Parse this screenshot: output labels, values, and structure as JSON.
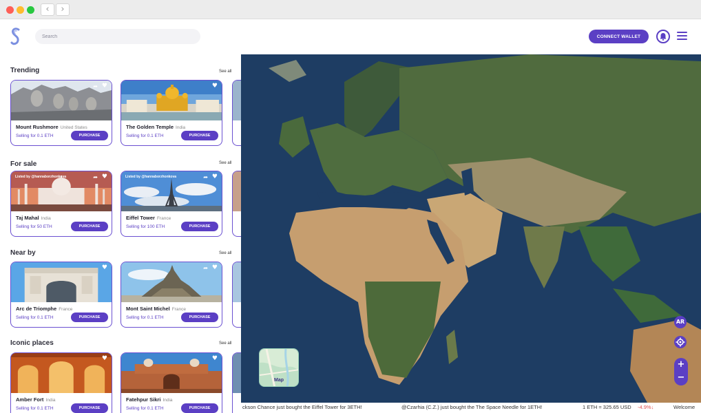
{
  "header": {
    "search_placeholder": "Search",
    "connect_label": "CONNECT WALLET"
  },
  "sections": [
    {
      "title": "Trending",
      "see_all": "See all",
      "cards": [
        {
          "name": "Mount Rushmore",
          "country": "United States",
          "price": "Selling for 0.1 ETH",
          "button": "PURCHASE"
        },
        {
          "name": "The Golden Temple",
          "country": "India",
          "price": "Selling for 0.1 ETH",
          "button": "PURCHASE"
        }
      ]
    },
    {
      "title": "For sale",
      "see_all": "See all",
      "cards": [
        {
          "name": "Taj Mahal",
          "country": "India",
          "price": "Selling for 50 ETH",
          "button": "PURCHASE",
          "listed": "Listed by @hannaborzhonkova"
        },
        {
          "name": "Eiffel Tower",
          "country": "France",
          "price": "Selling for 100 ETH",
          "button": "PURCHASE",
          "listed": "Listed by @hannaborzhonkova"
        }
      ]
    },
    {
      "title": "Near by",
      "see_all": "See all",
      "cards": [
        {
          "name": "Arc de Triomphe",
          "country": "France",
          "price": "Selling for 0.1 ETH",
          "button": "PURCHASE"
        },
        {
          "name": "Mont Saint Michel",
          "country": "France",
          "price": "Selling for 0.1 ETH",
          "button": "PURCHASE"
        }
      ]
    },
    {
      "title": "Iconic places",
      "see_all": "See all",
      "cards": [
        {
          "name": "Amber Fort",
          "country": "India",
          "price": "Selling for 0.1 ETH",
          "button": "PURCHASE"
        },
        {
          "name": "Fatehpur Sikri",
          "country": "India",
          "price": "Selling for 0.1 ETH",
          "button": "PURCHASE"
        }
      ]
    }
  ],
  "map": {
    "ar_label": "AR",
    "zoom_in": "+",
    "zoom_out": "−",
    "thumb_label": "Map"
  },
  "ticker": {
    "item1": "ckson Chance just bought the Eiffel Tower for 3ETH!",
    "item2": "@Czarhia (C.Z.) just bought the The Space Needle for 1ETH!",
    "rate": "1 ETH = 325.65 USD",
    "change": "-4.9%↓",
    "welcome": "Welcome"
  },
  "colors": {
    "accent": "#5b3fc4",
    "negative": "#e2504f"
  }
}
